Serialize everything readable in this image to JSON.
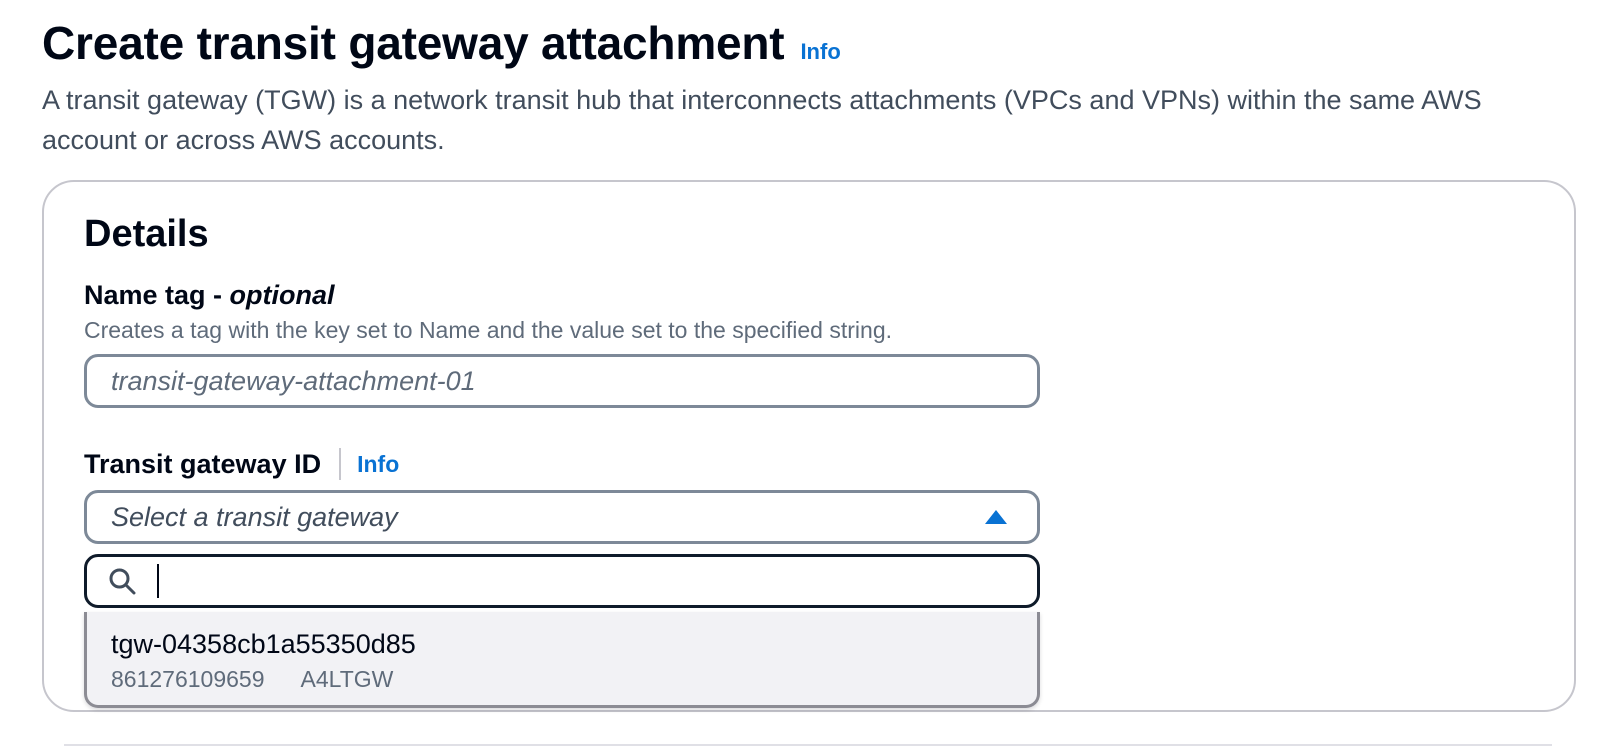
{
  "header": {
    "title": "Create transit gateway attachment",
    "info_label": "Info",
    "description": "A transit gateway (TGW) is a network transit hub that interconnects attachments (VPCs and VPNs) within the same AWS account or across AWS accounts."
  },
  "details": {
    "title": "Details",
    "name_tag": {
      "label": "Name tag - ",
      "optional_label": "optional",
      "description": "Creates a tag with the key set to Name and the value set to the specified string.",
      "placeholder": "transit-gateway-attachment-01",
      "value": ""
    },
    "transit_gateway": {
      "label": "Transit gateway ID",
      "info_label": "Info",
      "placeholder": "Select a transit gateway",
      "filter_value": "",
      "options": [
        {
          "id": "tgw-04358cb1a55350d85",
          "account": "861276109659",
          "name": "A4LTGW"
        }
      ]
    }
  },
  "colors": {
    "link": "#0972d3",
    "text": "#000716",
    "muted": "#5f6b7a",
    "border": "#7d8998",
    "focus_border": "#0f1b2a"
  },
  "icons": {
    "filter": "search-icon",
    "select_state": "caret-up-icon"
  }
}
